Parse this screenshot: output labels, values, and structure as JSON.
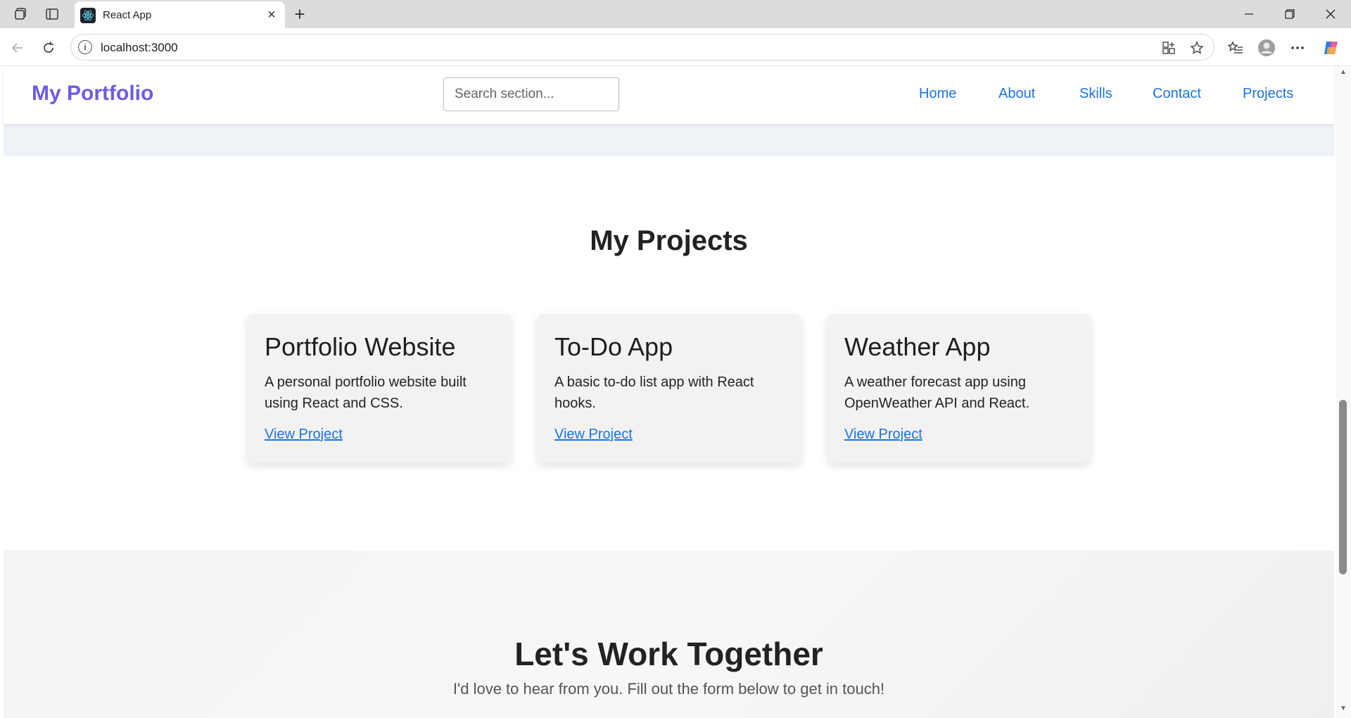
{
  "browser": {
    "tab_title": "React App",
    "url": "localhost:3000"
  },
  "site": {
    "logo": "My Portfolio",
    "search_placeholder": "Search section...",
    "nav": [
      "Home",
      "About",
      "Skills",
      "Contact",
      "Projects"
    ]
  },
  "projects": {
    "title": "My Projects",
    "cards": [
      {
        "title": "Portfolio Website",
        "desc": "A personal portfolio website built using React and CSS.",
        "link": "View Project"
      },
      {
        "title": "To-Do App",
        "desc": "A basic to-do list app with React hooks.",
        "link": "View Project"
      },
      {
        "title": "Weather App",
        "desc": "A weather forecast app using OpenWeather API and React.",
        "link": "View Project"
      }
    ]
  },
  "contact": {
    "title": "Let's Work Together",
    "subtitle": "I'd love to hear from you. Fill out the form below to get in touch!"
  },
  "colors": {
    "brand": "#6c5ce7",
    "link": "#1a73e8"
  }
}
